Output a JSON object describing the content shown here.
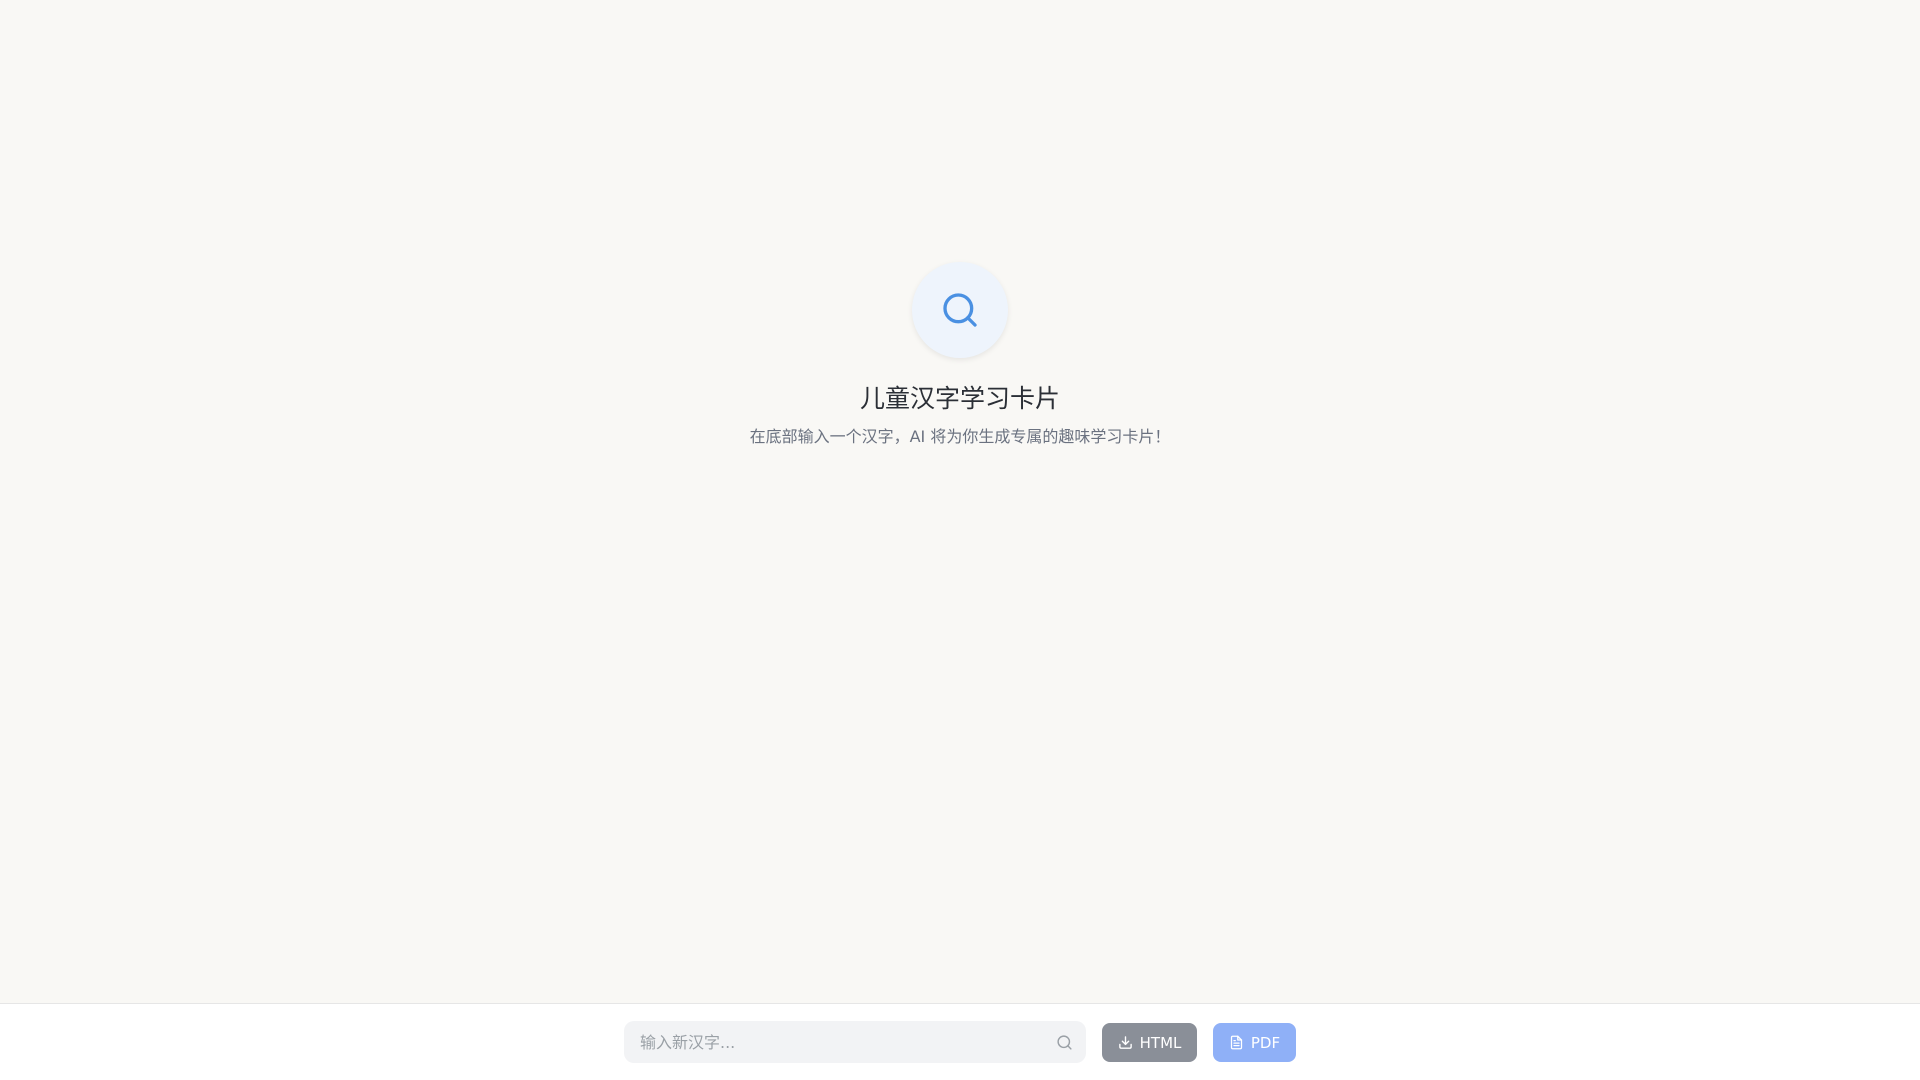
{
  "hero": {
    "icon": "search-icon",
    "title": "儿童汉字学习卡片",
    "subtitle": "在底部输入一个汉字，AI 将为你生成专属的趣味学习卡片！",
    "accent_color": "#4a90e2",
    "circle_color": "#eef4fc"
  },
  "bottom_bar": {
    "search": {
      "placeholder": "输入新汉字...",
      "value": "",
      "icon": "search-icon"
    },
    "buttons": [
      {
        "label": "HTML",
        "icon": "download-icon",
        "color": "#8a8f98"
      },
      {
        "label": "PDF",
        "icon": "file-text-icon",
        "color": "#8fb0f7"
      }
    ]
  }
}
